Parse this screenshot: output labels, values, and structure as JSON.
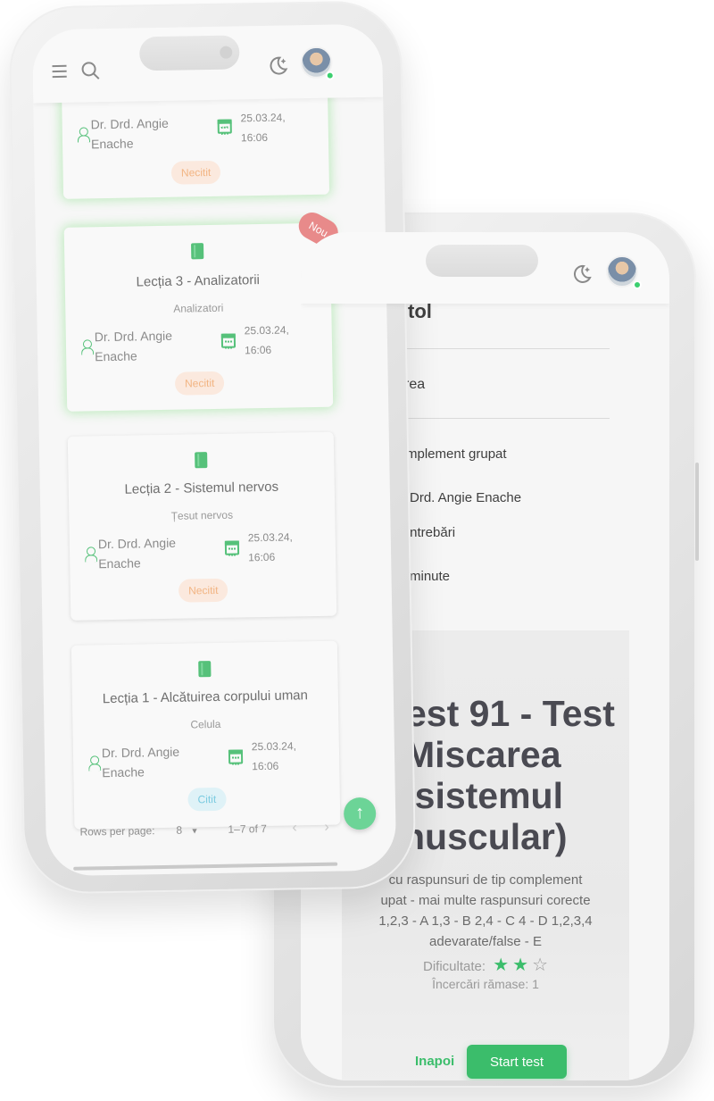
{
  "back_phone": {
    "heading_fragment": "tol",
    "row1": "rea",
    "type_line": "mplement grupat",
    "author_line": "Drd. Angie Enache",
    "questions_line": "întrebări",
    "time_line": "minute",
    "test_title": "est 91 - Test Miscarea (sistemul muscular)",
    "test_title_lines": [
      "est 91 - Test",
      "Miscarea",
      "(sistemul",
      "nuscular)"
    ],
    "description_lines": [
      "cu raspunsuri de tip complement",
      "upat - mai multe raspunsuri corecte",
      "1,2,3 - A 1,3 - B 2,4 - C 4 - D 1,2,3,4",
      "adevarate/false - E"
    ],
    "difficulty_label": "Dificultate:",
    "difficulty_rating": 2,
    "difficulty_max": 3,
    "attempts_label": "Încercări rămase: 1",
    "back_button": "Inapoi",
    "start_button": "Start test"
  },
  "front_phone": {
    "lessons": [
      {
        "title": "",
        "subtitle": "",
        "author_line1": "Dr. Drd. Angie",
        "author_line2": "Enache",
        "date_line1": "25.03.24,",
        "date_line2": "16:06",
        "status": "Necitit",
        "is_new": false
      },
      {
        "title": "Lecția 3 - Analizatorii",
        "subtitle": "Analizatori",
        "author_line1": "Dr. Drd. Angie",
        "author_line2": "Enache",
        "date_line1": "25.03.24,",
        "date_line2": "16:06",
        "status": "Necitit",
        "is_new": true,
        "new_label": "Nou"
      },
      {
        "title": "Lecția 2 - Sistemul nervos",
        "subtitle": "Țesut nervos",
        "author_line1": "Dr. Drd. Angie",
        "author_line2": "Enache",
        "date_line1": "25.03.24,",
        "date_line2": "16:06",
        "status": "Necitit",
        "is_new": false
      },
      {
        "title": "Lecția 1 - Alcătuirea corpului uman",
        "subtitle": "Celula",
        "author_line1": "Dr. Drd. Angie",
        "author_line2": "Enache",
        "date_line1": "25.03.24,",
        "date_line2": "16:06",
        "status": "Citit",
        "is_new": false
      }
    ],
    "pagination": {
      "rows_label": "Rows per page:",
      "rows_value": "8",
      "range": "1–7 of 7"
    }
  },
  "icons": {
    "menu": "menu-icon",
    "search": "search-icon",
    "theme": "moon-icon",
    "scroll_top": "arrow-up-icon"
  },
  "colors": {
    "accent": "#3bbd6b",
    "unread": "#f2b482",
    "read": "#7bcbe0",
    "new": "#e88a8a"
  }
}
